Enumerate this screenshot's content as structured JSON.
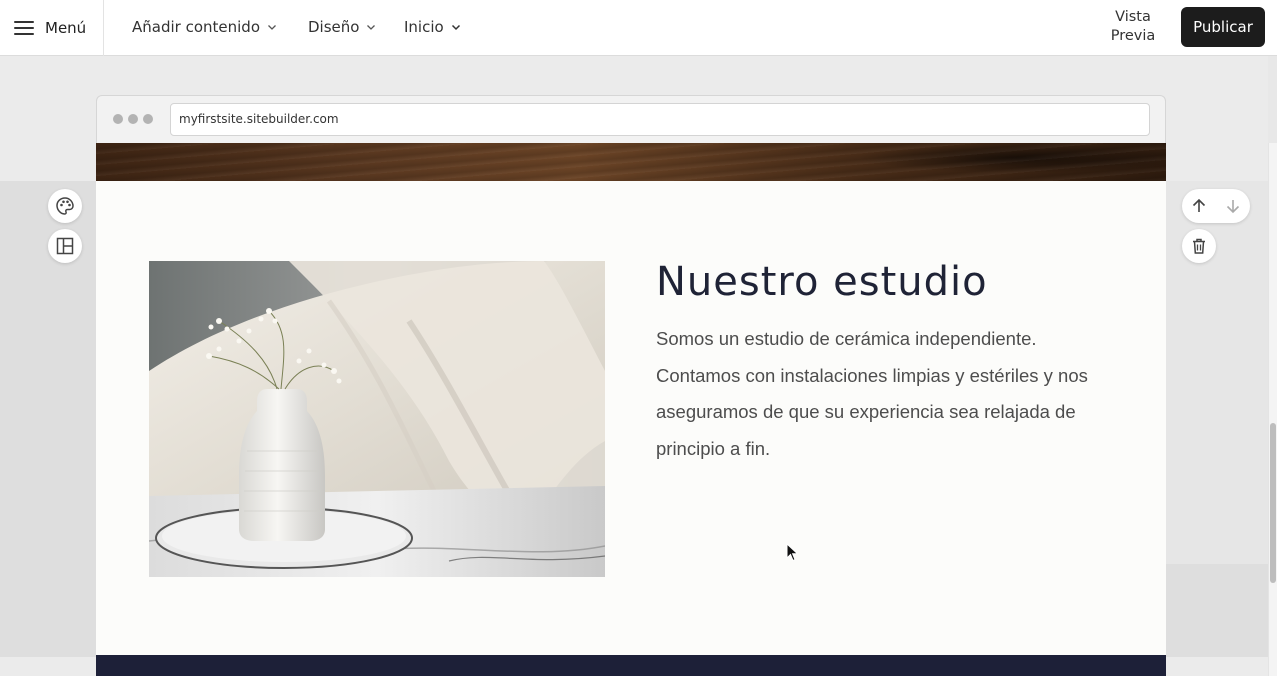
{
  "topbar": {
    "menu_label": "Menú",
    "nav": {
      "add_content": "Añadir contenido",
      "design": "Diseño",
      "home": "Inicio"
    },
    "preview_line1": "Vista",
    "preview_line2": "Previa",
    "publish_label": "Publicar"
  },
  "browser": {
    "url": "myfirstsite.sitebuilder.com"
  },
  "section": {
    "title": "Nuestro estudio",
    "body": "Somos un estudio de cerámica independiente. Contamos con instalaciones limpias y estériles y nos aseguramos de que su experiencia sea relajada de principio a fin."
  },
  "colors": {
    "publish_bg": "#1c1c1c",
    "title_color": "#1f2336",
    "footer_dark": "#1d2038",
    "content_bg": "#fcfcfa"
  },
  "icons": {
    "menu": "hamburger-icon",
    "palette": "palette-icon",
    "layout": "layout-icon",
    "move_up": "arrow-up-icon",
    "move_down": "arrow-down-icon",
    "delete": "trash-icon",
    "dropdown": "chevron-down-icon"
  }
}
